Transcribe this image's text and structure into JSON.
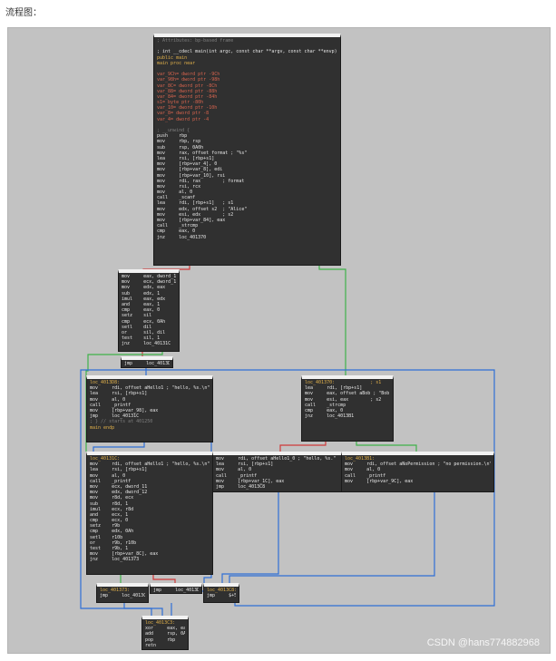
{
  "caption": "流程图：",
  "watermark": "CSDN @hans774882968",
  "colors": {
    "true_edge": "#3fb24a",
    "false_edge": "#d03a3a",
    "jump_edge": "#2f6fd6",
    "block_bg": "#303030",
    "panel_bg": "#c2c2c2"
  },
  "blocks": [
    {
      "id": "main",
      "lines": [
        {
          "t": "; Attributes: bp-based frame",
          "c": "cmt"
        },
        {
          "t": "",
          "c": ""
        },
        {
          "t": "; int __cdecl main(int argc, const char **argv, const char **envp)",
          "c": ""
        },
        {
          "t": "public main",
          "c": "kw"
        },
        {
          "t": "main proc near",
          "c": "kw"
        },
        {
          "t": "",
          "c": ""
        },
        {
          "t": "var_9Ch= dword ptr -9Ch",
          "c": "var"
        },
        {
          "t": "var_98h= dword ptr -98h",
          "c": "var"
        },
        {
          "t": "var_8C= dword ptr -8Ch",
          "c": "var"
        },
        {
          "t": "var_88= dword ptr -88h",
          "c": "var"
        },
        {
          "t": "var_84= dword ptr -84h",
          "c": "var"
        },
        {
          "t": "s1= byte ptr -80h",
          "c": "var"
        },
        {
          "t": "var_10= dword ptr -10h",
          "c": "var"
        },
        {
          "t": "var_8= dword ptr -8",
          "c": "var"
        },
        {
          "t": "var_4= dword ptr -4",
          "c": "var"
        },
        {
          "t": "",
          "c": ""
        },
        {
          "t": "; __unwind {",
          "c": "cmt"
        },
        {
          "t": "push    rbp",
          "c": ""
        },
        {
          "t": "mov     rbp, rsp",
          "c": ""
        },
        {
          "t": "sub     rsp, 0A0h",
          "c": ""
        },
        {
          "t": "mov     rax, offset format ; \"%s\"",
          "c": ""
        },
        {
          "t": "lea     rsi, [rbp+s1]",
          "c": ""
        },
        {
          "t": "mov     [rbp+var_4], 0",
          "c": ""
        },
        {
          "t": "mov     [rbp+var_8], edi",
          "c": ""
        },
        {
          "t": "mov     [rbp+var_10], rsi",
          "c": ""
        },
        {
          "t": "mov     rdi, rax        ; format",
          "c": ""
        },
        {
          "t": "mov     rsi, rcx",
          "c": ""
        },
        {
          "t": "mov     al, 0",
          "c": ""
        },
        {
          "t": "call    _scanf",
          "c": ""
        },
        {
          "t": "lea     rdi, [rbp+s1]   ; s1",
          "c": ""
        },
        {
          "t": "mov     edx, offset s2  ; \"Alice\"",
          "c": ""
        },
        {
          "t": "mov     esi, edx        ; s2",
          "c": ""
        },
        {
          "t": "mov     [rbp+var_84], eax",
          "c": ""
        },
        {
          "t": "call    _strcmp",
          "c": ""
        },
        {
          "t": "cmp     eax, 0",
          "c": ""
        },
        {
          "t": "jnz     loc_401370",
          "c": ""
        }
      ]
    },
    {
      "id": "check",
      "lines": [
        {
          "t": "mov     eax, dword_11",
          "c": ""
        },
        {
          "t": "mov     ecx, dword_12",
          "c": ""
        },
        {
          "t": "mov     edx, eax",
          "c": ""
        },
        {
          "t": "sub     edx, 1",
          "c": ""
        },
        {
          "t": "imul    eax, edx",
          "c": ""
        },
        {
          "t": "and     eax, 1",
          "c": ""
        },
        {
          "t": "cmp     eax, 0",
          "c": ""
        },
        {
          "t": "setz    sil",
          "c": ""
        },
        {
          "t": "cmp     ecx, 0Ah",
          "c": ""
        },
        {
          "t": "setl    dil",
          "c": ""
        },
        {
          "t": "or      sil, dil",
          "c": ""
        },
        {
          "t": "test    sil, 1",
          "c": ""
        },
        {
          "t": "jnz     loc_40131C",
          "c": ""
        }
      ]
    },
    {
      "id": "jmp1",
      "lines": [
        {
          "t": "jmp     loc_4013D8",
          "c": ""
        }
      ]
    },
    {
      "id": "loc_4013D8",
      "lines": [
        {
          "t": "loc_4013D8:",
          "c": "lbl"
        },
        {
          "t": "mov     rdi, offset aHello1 ; \"hello, %s.\\n\"",
          "c": ""
        },
        {
          "t": "lea     rsi, [rbp+s1]",
          "c": ""
        },
        {
          "t": "mov     al, 0",
          "c": ""
        },
        {
          "t": "call    _printf",
          "c": ""
        },
        {
          "t": "mov     [rbp+var_98], eax",
          "c": ""
        },
        {
          "t": "jmp     loc_40131C",
          "c": ""
        },
        {
          "t": "; } // starts at 401250",
          "c": "cmt"
        },
        {
          "t": "main endp",
          "c": "kw"
        }
      ]
    },
    {
      "id": "loc_401370",
      "lines": [
        {
          "t": "loc_401370:             ; s1",
          "c": "lbl"
        },
        {
          "t": "lea     rdi, [rbp+s1]",
          "c": ""
        },
        {
          "t": "mov     eax, offset aBob ; \"Bob\"",
          "c": ""
        },
        {
          "t": "mov     esi, eax        ; s2",
          "c": ""
        },
        {
          "t": "call    _strcmp",
          "c": ""
        },
        {
          "t": "cmp     eax, 0",
          "c": ""
        },
        {
          "t": "jnz     loc_4013B1",
          "c": ""
        }
      ]
    },
    {
      "id": "loc_40131C",
      "lines": [
        {
          "t": "loc_40131C:",
          "c": "lbl"
        },
        {
          "t": "mov     rdi, offset aHello1 ; \"hello, %s.\\n\"",
          "c": ""
        },
        {
          "t": "lea     rsi, [rbp+s1]",
          "c": ""
        },
        {
          "t": "mov     al, 0",
          "c": ""
        },
        {
          "t": "call    _printf",
          "c": ""
        },
        {
          "t": "mov     ecx, dword_11",
          "c": ""
        },
        {
          "t": "mov     edx, dword_12",
          "c": ""
        },
        {
          "t": "mov     r8d, ecx",
          "c": ""
        },
        {
          "t": "sub     r8d, 1",
          "c": ""
        },
        {
          "t": "imul    ecx, r8d",
          "c": ""
        },
        {
          "t": "and     ecx, 1",
          "c": ""
        },
        {
          "t": "cmp     ecx, 0",
          "c": ""
        },
        {
          "t": "setz    r9b",
          "c": ""
        },
        {
          "t": "cmp     edx, 0Ah",
          "c": ""
        },
        {
          "t": "setl    r10b",
          "c": ""
        },
        {
          "t": "or      r9b, r10b",
          "c": ""
        },
        {
          "t": "test    r9b, 1",
          "c": ""
        },
        {
          "t": "mov     [rbp+var_8C], eax",
          "c": ""
        },
        {
          "t": "jnz     loc_401373",
          "c": ""
        }
      ]
    },
    {
      "id": "bob",
      "lines": [
        {
          "t": "mov     rdi, offset aHello1_0 ; \"hello, %s.\"",
          "c": ""
        },
        {
          "t": "lea     rsi, [rbp+s1]",
          "c": ""
        },
        {
          "t": "mov     al, 0",
          "c": ""
        },
        {
          "t": "call    _printf",
          "c": ""
        },
        {
          "t": "mov     [rbp+var_1C], eax",
          "c": ""
        },
        {
          "t": "jmp     loc_4013C8",
          "c": ""
        }
      ]
    },
    {
      "id": "loc_4013B1",
      "lines": [
        {
          "t": "loc_4013B1:",
          "c": "lbl"
        },
        {
          "t": "mov     rdi, offset aNoPermission ; \"no permission.\\n\"",
          "c": ""
        },
        {
          "t": "mov     al, 0",
          "c": ""
        },
        {
          "t": "call    _printf",
          "c": ""
        },
        {
          "t": "mov     [rbp+var_9C], eax",
          "c": ""
        }
      ]
    },
    {
      "id": "loc_401373",
      "lines": [
        {
          "t": "loc_401373:",
          "c": "lbl"
        },
        {
          "t": "jmp     loc_4013C3",
          "c": ""
        }
      ]
    },
    {
      "id": "jmp2",
      "lines": [
        {
          "t": "jmp     loc_4013D8",
          "c": ""
        }
      ]
    },
    {
      "id": "loc_4013C8",
      "lines": [
        {
          "t": "loc_4013C8:",
          "c": "lbl"
        },
        {
          "t": "jmp     $+5",
          "c": ""
        }
      ]
    },
    {
      "id": "loc_4013C3",
      "lines": [
        {
          "t": "loc_4013C3:",
          "c": "lbl"
        },
        {
          "t": "xor     eax, eax",
          "c": ""
        },
        {
          "t": "add     rsp, 0A0h",
          "c": ""
        },
        {
          "t": "pop     rbp",
          "c": ""
        },
        {
          "t": "retn",
          "c": ""
        }
      ]
    }
  ]
}
